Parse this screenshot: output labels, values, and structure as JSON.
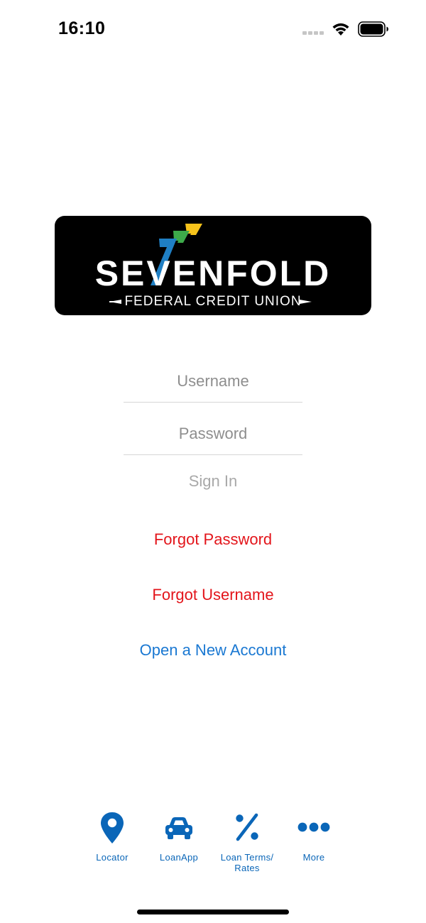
{
  "status_bar": {
    "time": "16:10",
    "icons": [
      "cellular-signal-icon",
      "wifi-icon",
      "battery-icon"
    ]
  },
  "logo": {
    "name": "SEVENFOLD",
    "subtitle": "FEDERAL CREDIT UNION",
    "colors": {
      "background": "#000000",
      "stripe_blue": "#1f7fc4",
      "stripe_green": "#3daa4a",
      "stripe_yellow": "#f7c31b",
      "text": "#ffffff"
    }
  },
  "login": {
    "username_placeholder": "Username",
    "password_placeholder": "Password",
    "sign_in_label": "Sign In",
    "forgot_password_label": "Forgot Password",
    "forgot_username_label": "Forgot Username",
    "open_account_label": "Open a New Account"
  },
  "colors": {
    "link_red": "#e3151b",
    "link_blue": "#1a78d2",
    "disabled_gray": "#a9a9a9",
    "tab_blue": "#0a66b8"
  },
  "tab_bar": {
    "items": [
      {
        "label": "Locator",
        "icon": "map-pin-icon"
      },
      {
        "label": "LoanApp",
        "icon": "car-icon"
      },
      {
        "label_line1": "Loan Terms/",
        "label_line2": "Rates",
        "icon": "percent-icon"
      },
      {
        "label": "More",
        "icon": "more-dots-icon"
      }
    ]
  }
}
